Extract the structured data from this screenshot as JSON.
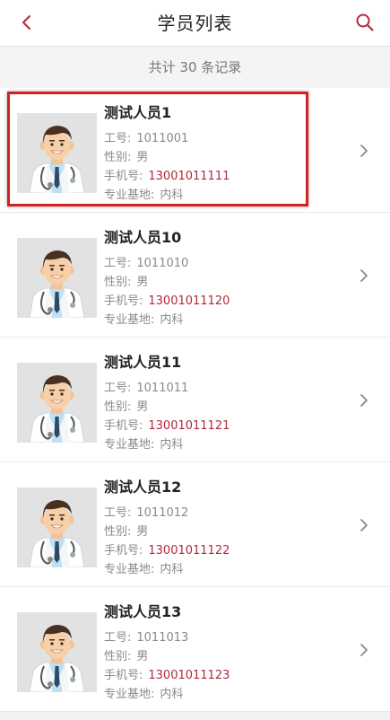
{
  "header": {
    "title": "学员列表",
    "back_icon": "chevron-left-icon",
    "search_icon": "search-icon"
  },
  "summary": "共计 30 条记录",
  "colors": {
    "accent": "#b02a3b",
    "selection_border": "#d42020"
  },
  "labels": {
    "id": "工号:",
    "gender": "性别:",
    "phone": "手机号:",
    "base": "专业基地:"
  },
  "students": [
    {
      "name": "测试人员1",
      "id": "1011001",
      "gender": "男",
      "phone": "13001011111",
      "base": "内科",
      "selected": true
    },
    {
      "name": "测试人员10",
      "id": "1011010",
      "gender": "男",
      "phone": "13001011120",
      "base": "内科",
      "selected": false
    },
    {
      "name": "测试人员11",
      "id": "1011011",
      "gender": "男",
      "phone": "13001011121",
      "base": "内科",
      "selected": false
    },
    {
      "name": "测试人员12",
      "id": "1011012",
      "gender": "男",
      "phone": "13001011122",
      "base": "内科",
      "selected": false
    },
    {
      "name": "测试人员13",
      "id": "1011013",
      "gender": "男",
      "phone": "13001011123",
      "base": "内科",
      "selected": false
    }
  ]
}
